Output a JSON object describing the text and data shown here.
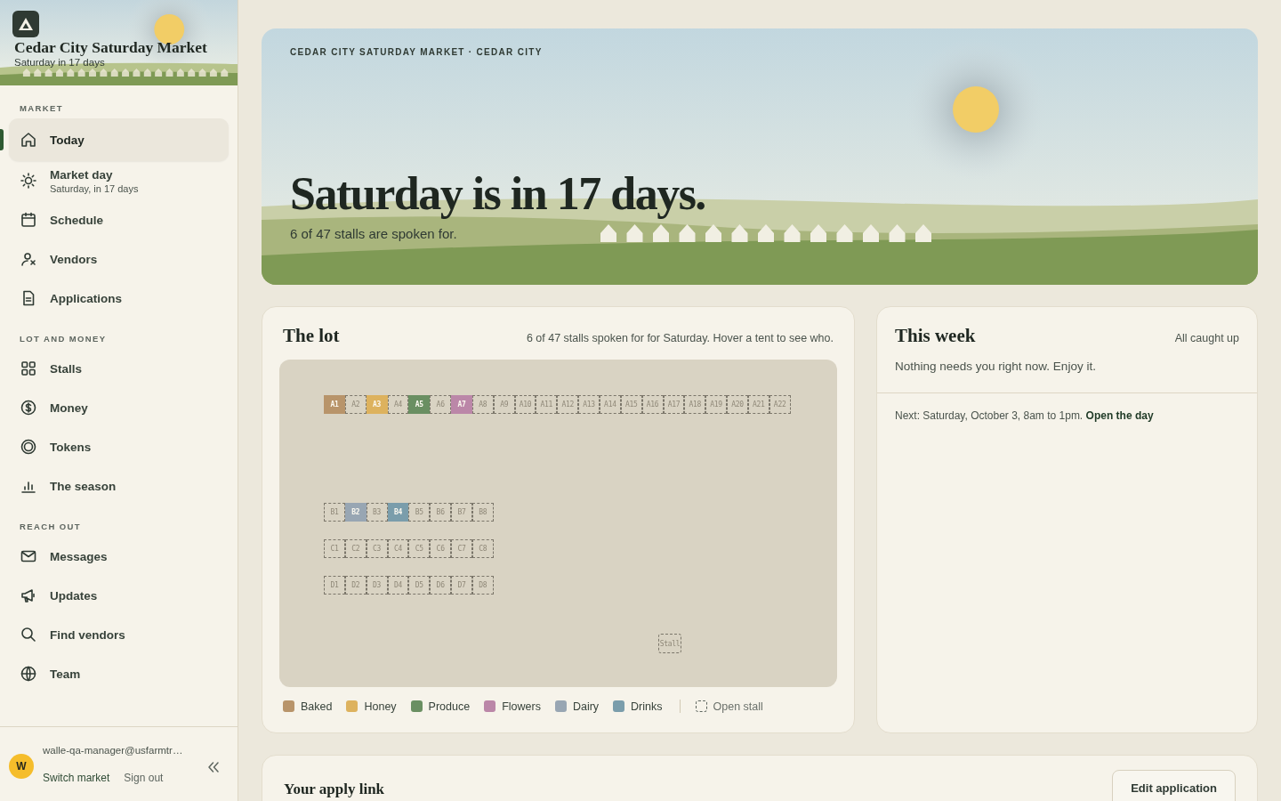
{
  "sidebar": {
    "market_name": "Cedar City Saturday Market",
    "market_subtitle": "Saturday in 17 days",
    "sections": [
      {
        "heading": "MARKET",
        "items": [
          {
            "label": "Today",
            "selected": true
          },
          {
            "label": "Market day",
            "sublabel": "Saturday, in 17 days",
            "selected": false
          },
          {
            "label": "Schedule",
            "selected": false
          },
          {
            "label": "Vendors",
            "selected": false
          },
          {
            "label": "Applications",
            "selected": false
          }
        ]
      },
      {
        "heading": "LOT AND MONEY",
        "items": [
          {
            "label": "Stalls",
            "selected": false
          },
          {
            "label": "Money",
            "selected": false
          },
          {
            "label": "Tokens",
            "selected": false
          },
          {
            "label": "The season",
            "selected": false
          }
        ]
      },
      {
        "heading": "REACH OUT",
        "items": [
          {
            "label": "Messages",
            "selected": false
          },
          {
            "label": "Updates",
            "selected": false
          },
          {
            "label": "Find vendors",
            "selected": false
          },
          {
            "label": "Team",
            "selected": false
          }
        ]
      }
    ],
    "account": {
      "avatar_initial": "W",
      "email": "walle-qa-manager@usfarmtr…",
      "links": [
        "Switch market",
        "Sign out"
      ]
    }
  },
  "hero": {
    "eyebrow": "CEDAR CITY SATURDAY MARKET · CEDAR CITY",
    "title": "Saturday is in 17 days.",
    "subtitle": "6 of 47 stalls are spoken for."
  },
  "lot": {
    "title": "The lot",
    "note": "6 of 47 stalls spoken for for Saturday. Hover a tent to see who.",
    "rows": [
      {
        "stalls": [
          {
            "label": "A1",
            "taken": true,
            "color": "#b8946a"
          },
          {
            "label": "A2",
            "taken": false
          },
          {
            "label": "A3",
            "taken": true,
            "color": "#ddb25e"
          },
          {
            "label": "A4",
            "taken": false
          },
          {
            "label": "A5",
            "taken": true,
            "color": "#6a8f62"
          },
          {
            "label": "A6",
            "taken": false
          },
          {
            "label": "A7",
            "taken": true,
            "color": "#bb87a8"
          },
          {
            "label": "A8",
            "taken": false
          },
          {
            "label": "A9",
            "taken": false
          },
          {
            "label": "A10",
            "taken": false
          },
          {
            "label": "A11",
            "taken": false
          },
          {
            "label": "A12",
            "taken": false
          },
          {
            "label": "A13",
            "taken": false
          },
          {
            "label": "A14",
            "taken": false
          },
          {
            "label": "A15",
            "taken": false
          },
          {
            "label": "A16",
            "taken": false
          },
          {
            "label": "A17",
            "taken": false
          },
          {
            "label": "A18",
            "taken": false
          },
          {
            "label": "A19",
            "taken": false
          },
          {
            "label": "A20",
            "taken": false
          },
          {
            "label": "A21",
            "taken": false
          },
          {
            "label": "A22",
            "taken": false
          }
        ]
      },
      {
        "stalls": [
          {
            "label": "B1",
            "taken": false
          },
          {
            "label": "B2",
            "taken": true,
            "color": "#98a6b3"
          },
          {
            "label": "B3",
            "taken": false
          },
          {
            "label": "B4",
            "taken": true,
            "color": "#7a9dab"
          },
          {
            "label": "B5",
            "taken": false
          },
          {
            "label": "B6",
            "taken": false
          },
          {
            "label": "B7",
            "taken": false
          },
          {
            "label": "B8",
            "taken": false
          }
        ]
      },
      {
        "stalls": [
          {
            "label": "C1",
            "taken": false
          },
          {
            "label": "C2",
            "taken": false
          },
          {
            "label": "C3",
            "taken": false
          },
          {
            "label": "C4",
            "taken": false
          },
          {
            "label": "C5",
            "taken": false
          },
          {
            "label": "C6",
            "taken": false
          },
          {
            "label": "C7",
            "taken": false
          },
          {
            "label": "C8",
            "taken": false
          }
        ]
      },
      {
        "stalls": [
          {
            "label": "D1",
            "taken": false
          },
          {
            "label": "D2",
            "taken": false
          },
          {
            "label": "D3",
            "taken": false
          },
          {
            "label": "D4",
            "taken": false
          },
          {
            "label": "D5",
            "taken": false
          },
          {
            "label": "D6",
            "taken": false
          },
          {
            "label": "D7",
            "taken": false
          },
          {
            "label": "D8",
            "taken": false
          }
        ]
      }
    ],
    "loose_stalls": [
      {
        "label": "Stall",
        "taken": false
      }
    ],
    "legend": [
      {
        "label": "Baked",
        "color": "#b8946a"
      },
      {
        "label": "Honey",
        "color": "#ddb25e"
      },
      {
        "label": "Produce",
        "color": "#6a8f62"
      },
      {
        "label": "Flowers",
        "color": "#bb87a8"
      },
      {
        "label": "Dairy",
        "color": "#98a6b3"
      },
      {
        "label": "Drinks",
        "color": "#7a9dab"
      }
    ],
    "open_label": "Open stall"
  },
  "this_week": {
    "title": "This week",
    "status": "All caught up",
    "message": "Nothing needs you right now. Enjoy it.",
    "next": "Next: Saturday, October 3, 8am to 1pm.",
    "action": "Open the day"
  },
  "apply": {
    "title": "Your apply link",
    "button": "Edit application"
  }
}
